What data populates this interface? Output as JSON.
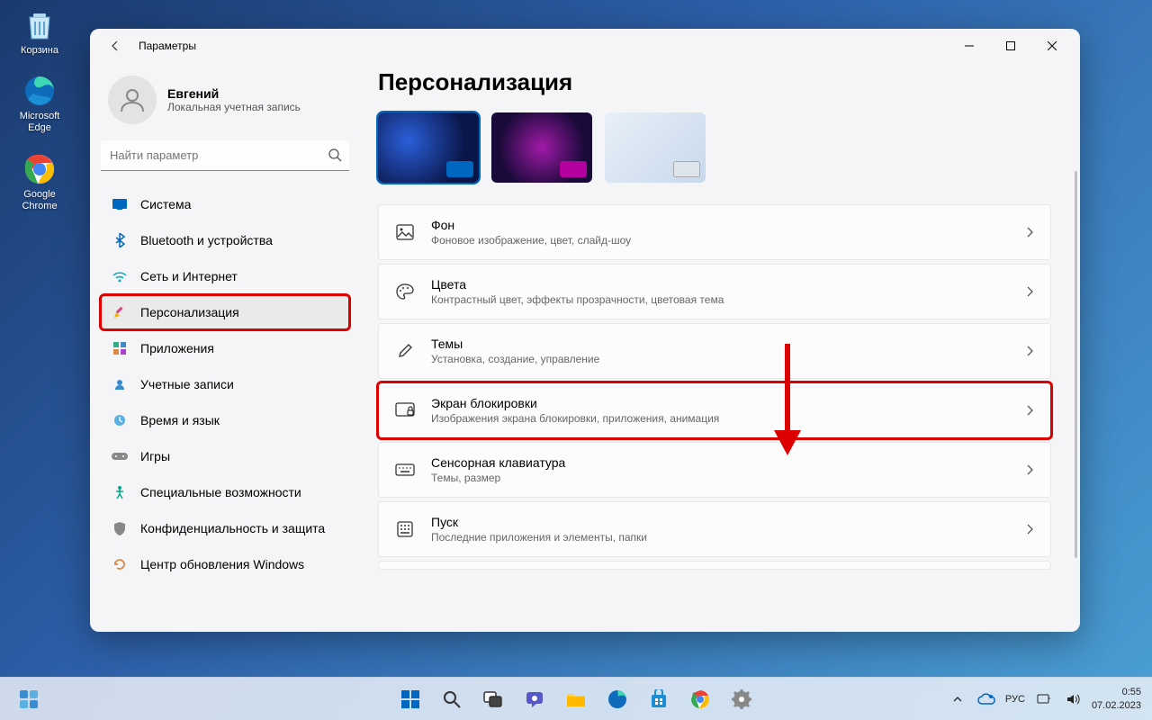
{
  "desktop": {
    "icons": [
      {
        "label": "Корзина"
      },
      {
        "label": "Microsoft Edge"
      },
      {
        "label": "Google Chrome"
      }
    ]
  },
  "window": {
    "title": "Параметры",
    "user": {
      "name": "Евгений",
      "sub": "Локальная учетная запись"
    },
    "search_placeholder": "Найти параметр",
    "nav": [
      {
        "label": "Система"
      },
      {
        "label": "Bluetooth и устройства"
      },
      {
        "label": "Сеть и Интернет"
      },
      {
        "label": "Персонализация"
      },
      {
        "label": "Приложения"
      },
      {
        "label": "Учетные записи"
      },
      {
        "label": "Время и язык"
      },
      {
        "label": "Игры"
      },
      {
        "label": "Специальные возможности"
      },
      {
        "label": "Конфиденциальность и защита"
      },
      {
        "label": "Центр обновления Windows"
      }
    ],
    "page": {
      "title": "Персонализация",
      "cards": [
        {
          "title": "Фон",
          "sub": "Фоновое изображение, цвет, слайд-шоу"
        },
        {
          "title": "Цвета",
          "sub": "Контрастный цвет, эффекты прозрачности, цветовая тема"
        },
        {
          "title": "Темы",
          "sub": "Установка, создание, управление"
        },
        {
          "title": "Экран блокировки",
          "sub": "Изображения экрана блокировки, приложения, анимация"
        },
        {
          "title": "Сенсорная клавиатура",
          "sub": "Темы, размер"
        },
        {
          "title": "Пуск",
          "sub": "Последние приложения и элементы, папки"
        }
      ]
    }
  },
  "taskbar": {
    "lang": "РУС",
    "time": "0:55",
    "date": "07.02.2023"
  }
}
